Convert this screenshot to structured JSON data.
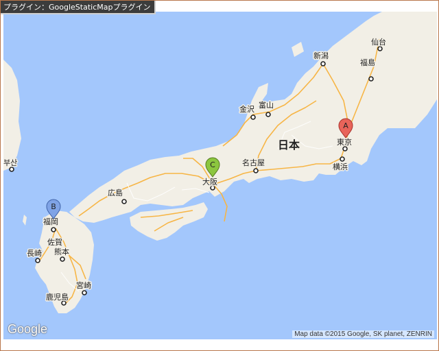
{
  "plugin_label": "プラグイン：GoogleStaticMapプラグイン",
  "country_label": "日本",
  "cities": [
    {
      "id": "sendai",
      "name": "仙台"
    },
    {
      "id": "niigata",
      "name": "新潟"
    },
    {
      "id": "fukushima",
      "name": "福島"
    },
    {
      "id": "toyama",
      "name": "富山"
    },
    {
      "id": "kanazawa",
      "name": "金沢"
    },
    {
      "id": "tokyo",
      "name": "東京"
    },
    {
      "id": "yokohama",
      "name": "横浜"
    },
    {
      "id": "nagoya",
      "name": "名古屋"
    },
    {
      "id": "osaka",
      "name": "大阪"
    },
    {
      "id": "hiroshima",
      "name": "広島"
    },
    {
      "id": "busan",
      "name": "부산"
    },
    {
      "id": "fukuoka",
      "name": "福岡"
    },
    {
      "id": "saga",
      "name": "佐賀"
    },
    {
      "id": "nagasaki",
      "name": "長崎"
    },
    {
      "id": "kumamoto",
      "name": "熊本"
    },
    {
      "id": "miyazaki",
      "name": "宮崎"
    },
    {
      "id": "kagoshima",
      "name": "鹿児島"
    }
  ],
  "markers": [
    {
      "label": "A",
      "place": "東京",
      "color": "#e8645a"
    },
    {
      "label": "B",
      "place": "福岡",
      "color": "#7fa3e6"
    },
    {
      "label": "C",
      "place": "大阪",
      "color": "#8cc63f"
    }
  ],
  "colors": {
    "water": "#a3c7fc",
    "land": "#f2efe6",
    "road": "#f7b545"
  },
  "logo_text": "Google",
  "attribution": "Map data ©2015 Google, SK planet, ZENRIN"
}
